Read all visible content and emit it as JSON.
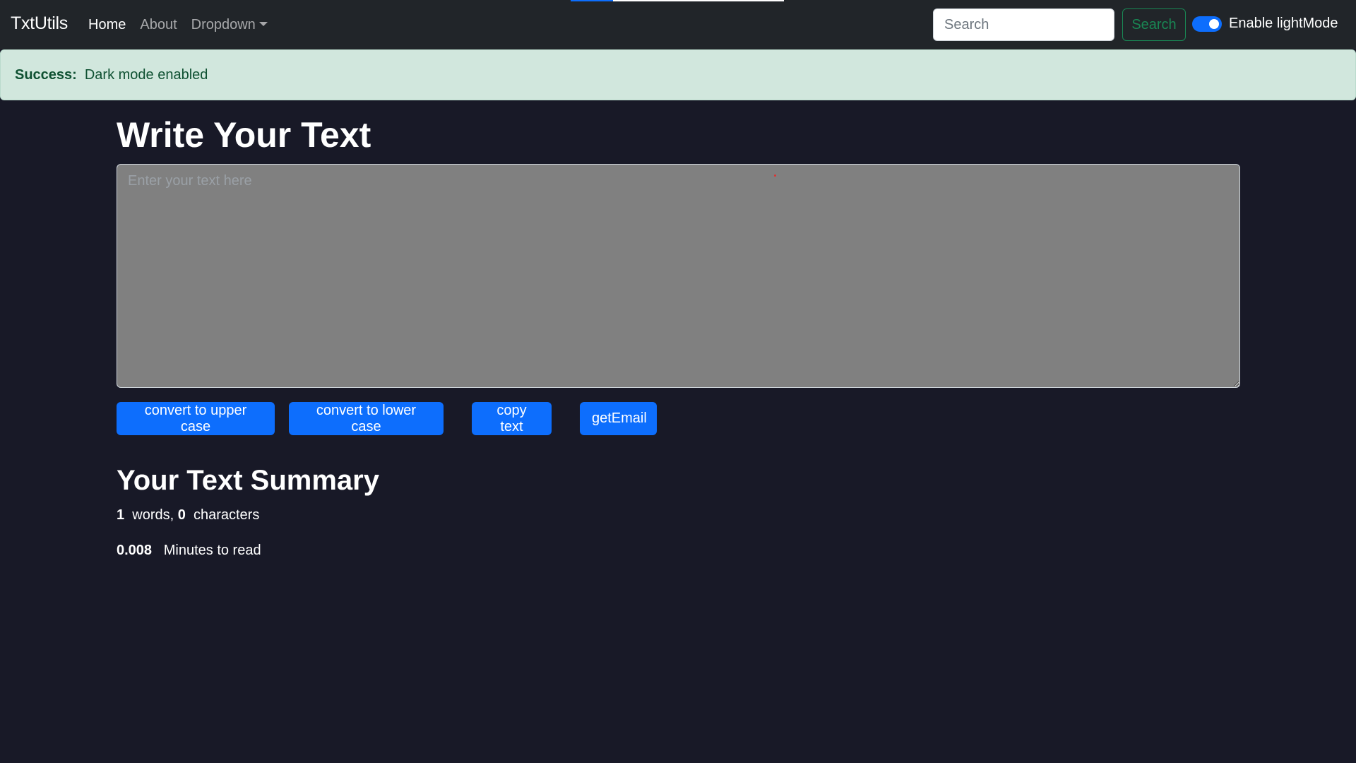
{
  "navbar": {
    "brand": "TxtUtils",
    "links": [
      "Home",
      "About",
      "Dropdown"
    ],
    "search_placeholder": "Search",
    "search_button": "Search",
    "toggle_label": "Enable lightMode",
    "toggle_on": true
  },
  "alert": {
    "title": "Success:",
    "message": "Dark mode enabled"
  },
  "main": {
    "heading": "Write Your Text",
    "textarea_placeholder": "Enter your text here",
    "textarea_value": "",
    "buttons": [
      "convert to upper case",
      "convert to lower case",
      "copy text",
      "getEmail"
    ]
  },
  "summary": {
    "heading": "Your Text Summary",
    "words": "1",
    "words_label": "words,",
    "characters": "0",
    "characters_label": "characters",
    "minutes": "0.008",
    "minutes_label": "Minutes to read"
  },
  "colors": {
    "background": "#181927",
    "navbar": "#212529",
    "primary": "#0d6efd",
    "success_outline": "#198754",
    "alert_bg": "#d1e7dd",
    "alert_text": "#0f5132",
    "textarea_bg": "#808080"
  }
}
